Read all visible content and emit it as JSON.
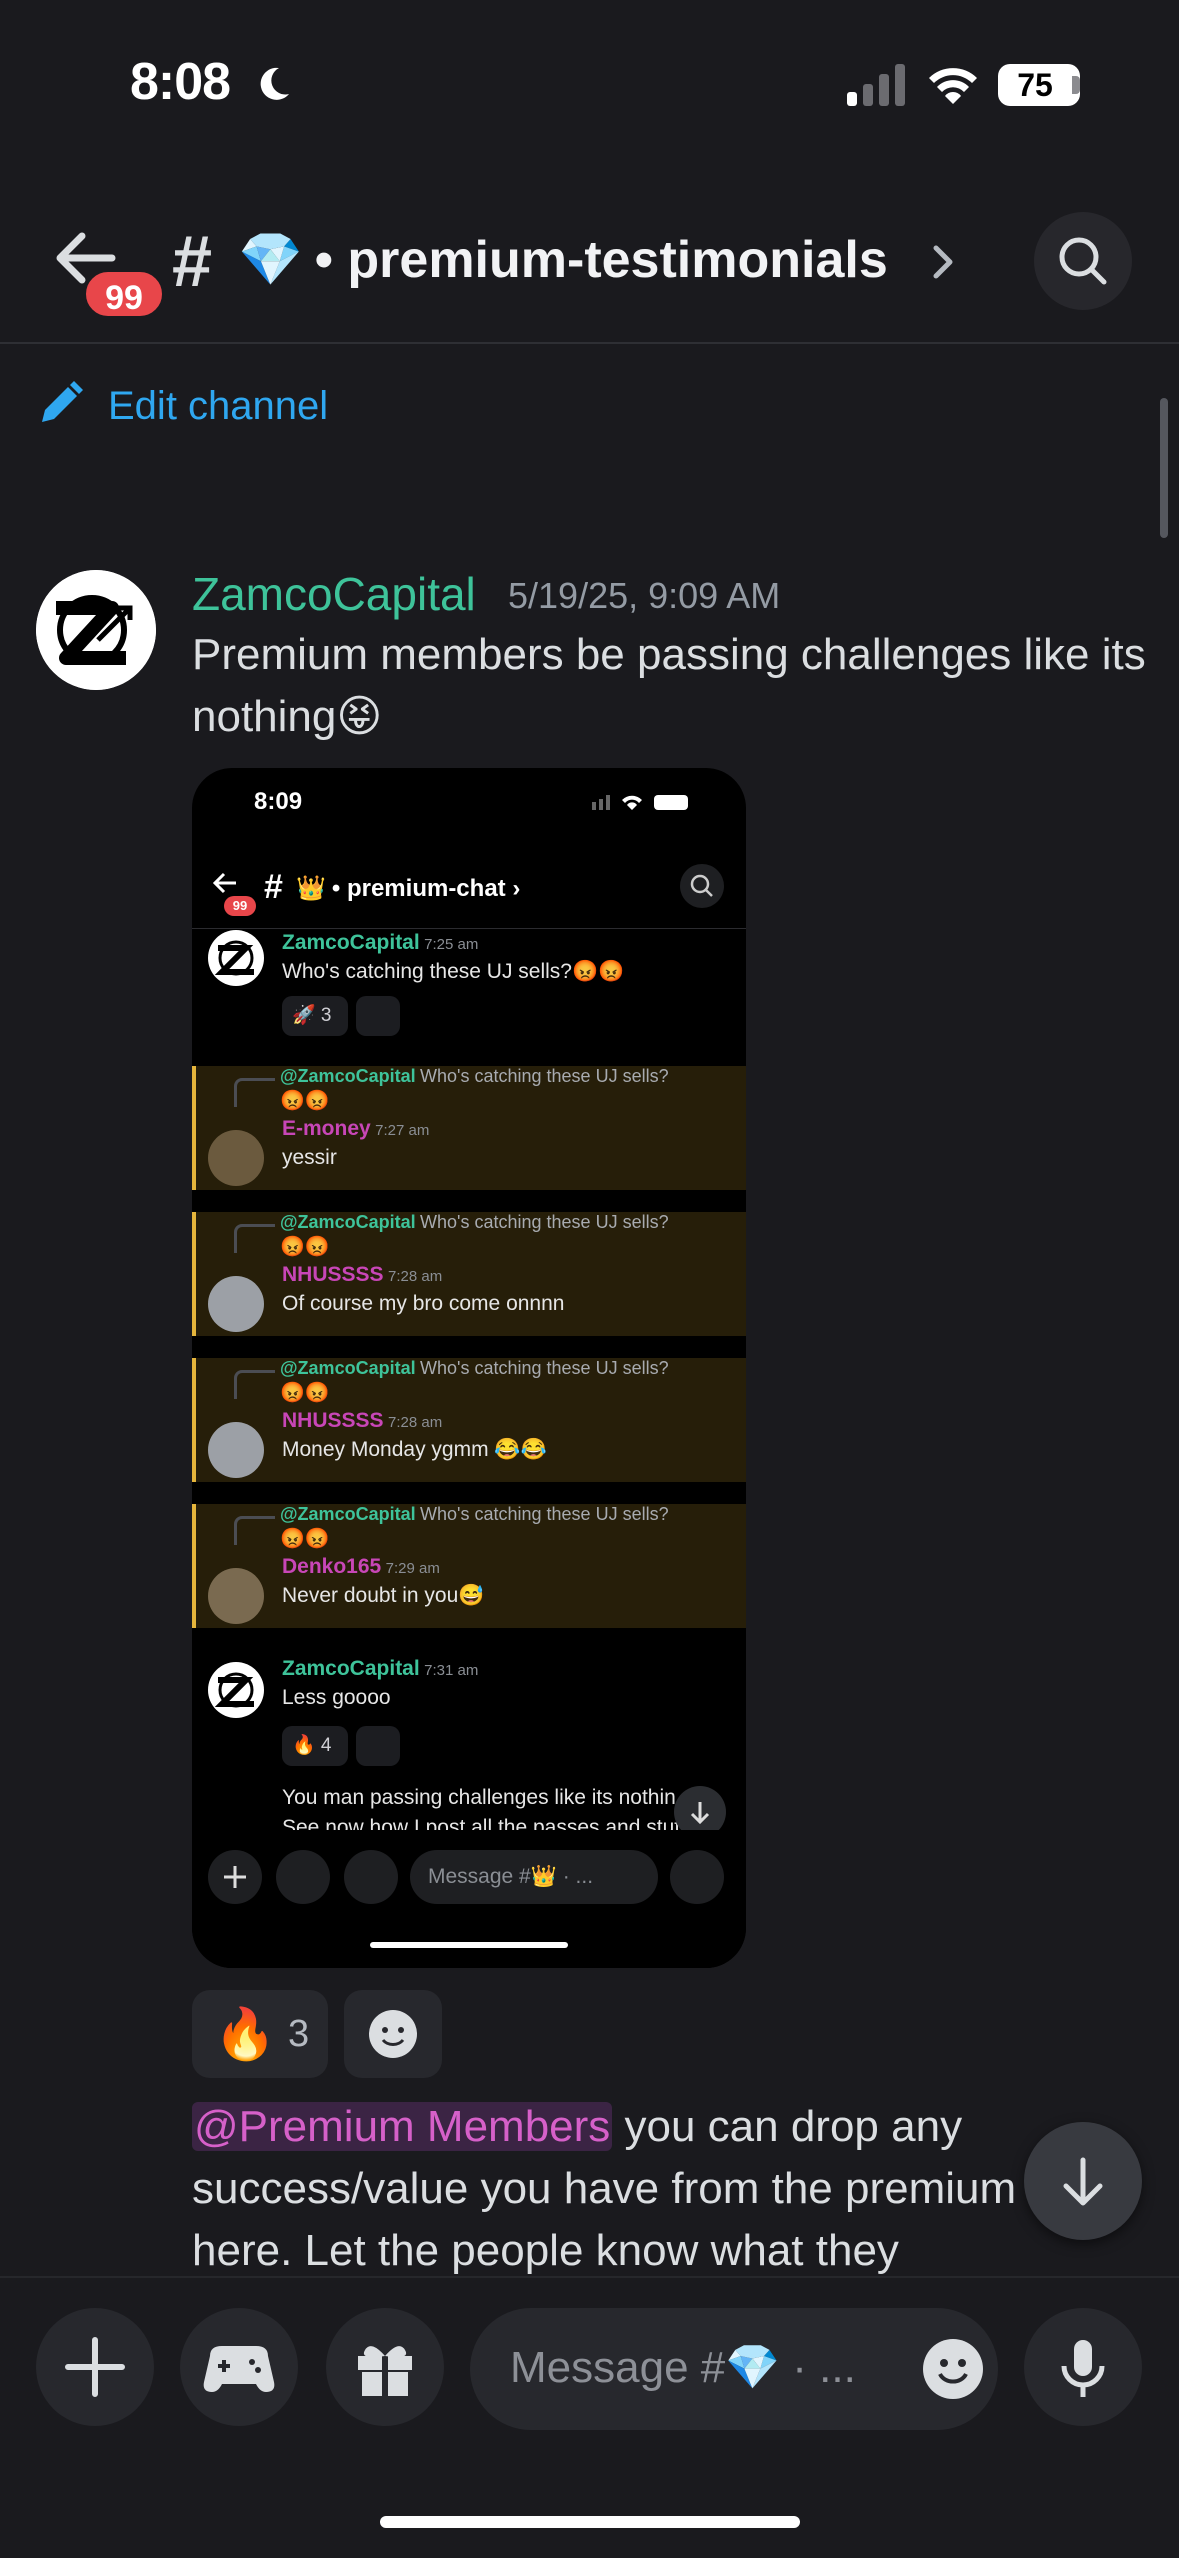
{
  "status_bar": {
    "time": "8:08",
    "battery": "75"
  },
  "header": {
    "badge": "99",
    "hash": "#",
    "channel_emoji": "💎",
    "channel_name": "• premium-testimonials",
    "edit_label": "Edit channel"
  },
  "message": {
    "author": "ZamcoCapital",
    "timestamp": "5/19/25, 9:09 AM",
    "text": "Premium members be passing challenges like its nothing😝",
    "reaction_emoji": "🔥",
    "reaction_count": "3"
  },
  "attachment": {
    "status_time": "8:09",
    "badge": "99",
    "channel_emoji": "👑",
    "channel_name": "• premium-chat",
    "reply_author": "@ZamcoCapital",
    "reply_text": "Who's catching these UJ sells?",
    "reply_emojis": "😡😡",
    "messages": [
      {
        "author": "ZamcoCapital",
        "time": "7:25 am",
        "text": "Who's catching these UJ sells?😡😡",
        "reaction": "🚀 3"
      },
      {
        "author": "E-money",
        "time": "7:27 am",
        "text": "yessir"
      },
      {
        "author": "NHUSSSS",
        "time": "7:28 am",
        "text": "Of course my bro come onnnn"
      },
      {
        "author": "NHUSSSS",
        "time": "7:28 am",
        "text": "Money Monday ygmm 😂😂"
      },
      {
        "author": "Denko165",
        "time": "7:29 am",
        "text": "Never doubt in you😅"
      },
      {
        "author": "ZamcoCapital",
        "time": "7:31 am",
        "text": "Less goooo",
        "reaction": "🔥 4"
      }
    ],
    "trailing_lines": [
      "You man passing challenges like its nothin",
      "See now how I post all the passes and stuff on"
    ],
    "input_placeholder": "Message #👑 · ..."
  },
  "message2": {
    "mention": "@Premium Members",
    "text": " you can drop any success/value you have from the premium group here. Let the people know what they"
  },
  "composer": {
    "placeholder": "Message #💎 · ..."
  }
}
